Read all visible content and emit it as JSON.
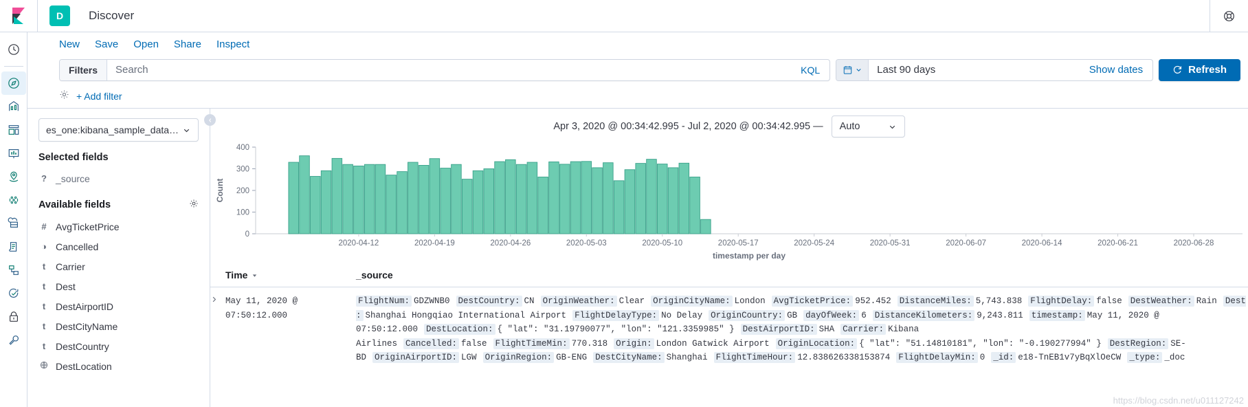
{
  "header": {
    "app_badge": "D",
    "title": "Discover",
    "logo_icon": "kibana-logo-icon",
    "help_icon": "help-circle-icon"
  },
  "rail": {
    "items": [
      {
        "name": "recently-viewed",
        "icon": "clock-icon",
        "active": false
      },
      {
        "name": "discover",
        "icon": "compass-icon",
        "active": true
      },
      {
        "name": "visualize",
        "icon": "bar-chart-icon",
        "active": false
      },
      {
        "name": "dashboard",
        "icon": "dashboard-icon",
        "active": false
      },
      {
        "name": "canvas",
        "icon": "presentation-icon",
        "active": false
      },
      {
        "name": "maps",
        "icon": "map-pin-icon",
        "active": false
      },
      {
        "name": "machine-learning",
        "icon": "ml-nodes-icon",
        "active": false
      },
      {
        "name": "infrastructure",
        "icon": "infra-icon",
        "active": false
      },
      {
        "name": "logs",
        "icon": "logs-document-icon",
        "active": false
      },
      {
        "name": "apm",
        "icon": "apm-trace-icon",
        "active": false
      },
      {
        "name": "uptime",
        "icon": "uptime-check-icon",
        "active": false
      },
      {
        "name": "security",
        "icon": "lock-icon",
        "active": false
      },
      {
        "name": "dev-tools",
        "icon": "wrench-icon",
        "active": false
      }
    ]
  },
  "nav": {
    "links": [
      "New",
      "Save",
      "Open",
      "Share",
      "Inspect"
    ]
  },
  "query_bar": {
    "filters_label": "Filters",
    "search_placeholder": "Search",
    "search_value": "",
    "language_label": "KQL",
    "calendar_icon": "calendar-icon",
    "chevron_icon": "chevron-down-icon",
    "date_range_label": "Last 90 days",
    "show_dates_label": "Show dates",
    "refresh_label": "Refresh",
    "refresh_icon": "refresh-icon",
    "accent_color": "#006BB4"
  },
  "filter_bar": {
    "settings_icon": "gear-icon",
    "add_filter_label": "+ Add filter"
  },
  "sidebar": {
    "index_pattern": "es_one:kibana_sample_data_flig...",
    "index_chevron_icon": "chevron-down-icon",
    "selected_fields_label": "Selected fields",
    "selected_fields": [
      {
        "type": "?",
        "name": "_source",
        "icon": "unknown-field-icon"
      }
    ],
    "available_fields_label": "Available fields",
    "available_fields_gear_icon": "gear-icon",
    "available_fields": [
      {
        "type": "#",
        "name": "AvgTicketPrice",
        "icon": "number-field-icon"
      },
      {
        "type": "◑",
        "name": "Cancelled",
        "icon": "boolean-field-icon"
      },
      {
        "type": "t",
        "name": "Carrier",
        "icon": "string-field-icon"
      },
      {
        "type": "t",
        "name": "Dest",
        "icon": "string-field-icon"
      },
      {
        "type": "t",
        "name": "DestAirportID",
        "icon": "string-field-icon"
      },
      {
        "type": "t",
        "name": "DestCityName",
        "icon": "string-field-icon"
      },
      {
        "type": "t",
        "name": "DestCountry",
        "icon": "string-field-icon"
      },
      {
        "type": "⊕",
        "name": "DestLocation",
        "icon": "geo-point-field-icon"
      }
    ]
  },
  "chart_header": {
    "range_text": "Apr 3, 2020 @ 00:34:42.995 - Jul 2, 2020 @ 00:34:42.995 —",
    "interval_value": "Auto",
    "interval_chevron_icon": "chevron-down-icon"
  },
  "chart_data": {
    "type": "bar",
    "title": "",
    "xlabel": "timestamp per day",
    "ylabel": "Count",
    "ylim": [
      0,
      400
    ],
    "yticks": [
      0,
      100,
      200,
      300,
      400
    ],
    "grid": false,
    "bar_color": "#6DCCB1",
    "bar_stroke": "#3aa18a",
    "x_axis_range": [
      "2020-04-03",
      "2020-07-02"
    ],
    "xticks": [
      "2020-04-12",
      "2020-04-19",
      "2020-04-26",
      "2020-05-03",
      "2020-05-10",
      "2020-05-17",
      "2020-05-24",
      "2020-05-31",
      "2020-06-07",
      "2020-06-14",
      "2020-06-21",
      "2020-06-28"
    ],
    "categories": [
      "2020-04-06",
      "2020-04-07",
      "2020-04-08",
      "2020-04-09",
      "2020-04-10",
      "2020-04-11",
      "2020-04-12",
      "2020-04-13",
      "2020-04-14",
      "2020-04-15",
      "2020-04-16",
      "2020-04-17",
      "2020-04-18",
      "2020-04-19",
      "2020-04-20",
      "2020-04-21",
      "2020-04-22",
      "2020-04-23",
      "2020-04-24",
      "2020-04-25",
      "2020-04-26",
      "2020-04-27",
      "2020-04-28",
      "2020-04-29",
      "2020-04-30",
      "2020-05-01",
      "2020-05-02",
      "2020-05-03",
      "2020-05-04",
      "2020-05-05",
      "2020-05-06",
      "2020-05-07",
      "2020-05-08",
      "2020-05-09",
      "2020-05-10",
      "2020-05-11"
    ],
    "values": [
      330,
      360,
      265,
      291,
      348,
      320,
      313,
      320,
      320,
      271,
      287,
      330,
      316,
      347,
      303,
      320,
      252,
      291,
      300,
      333,
      342,
      320,
      330,
      262,
      332,
      321,
      333,
      334,
      305,
      328,
      245,
      296,
      325,
      344,
      322,
      305
    ],
    "trailing_values": [
      326,
      262,
      66
    ]
  },
  "doc_table": {
    "columns": [
      "Time",
      "_source"
    ],
    "sort_icon": "sort-down-icon",
    "expand_icon": "chevron-right-icon",
    "rows": [
      {
        "time": "May 11, 2020 @ 07:50:12.000",
        "fields": [
          {
            "key": "FlightNum:",
            "value": "GDZWNB0"
          },
          {
            "key": "DestCountry:",
            "value": "CN"
          },
          {
            "key": "OriginWeather:",
            "value": "Clear"
          },
          {
            "key": "OriginCityName:",
            "value": "London"
          },
          {
            "key": "AvgTicketPrice:",
            "value": "952.452"
          },
          {
            "key": "DistanceMiles:",
            "value": "5,743.838"
          },
          {
            "key": "FlightDelay:",
            "value": "false"
          },
          {
            "key": "DestWeather:",
            "value": "Rain"
          },
          {
            "key": "Dest:",
            "value": "Shanghai Hongqiao International Airport"
          },
          {
            "key": "FlightDelayType:",
            "value": "No Delay"
          },
          {
            "key": "OriginCountry:",
            "value": "GB"
          },
          {
            "key": "dayOfWeek:",
            "value": "6"
          },
          {
            "key": "DistanceKilometers:",
            "value": "9,243.811"
          },
          {
            "key": "timestamp:",
            "value": "May 11, 2020 @ 07:50:12.000"
          },
          {
            "key": "DestLocation:",
            "value": "{ \"lat\": \"31.19790077\", \"lon\": \"121.3359985\" }"
          },
          {
            "key": "DestAirportID:",
            "value": "SHA"
          },
          {
            "key": "Carrier:",
            "value": "Kibana Airlines"
          },
          {
            "key": "Cancelled:",
            "value": "false"
          },
          {
            "key": "FlightTimeMin:",
            "value": "770.318"
          },
          {
            "key": "Origin:",
            "value": "London Gatwick Airport"
          },
          {
            "key": "OriginLocation:",
            "value": "{ \"lat\": \"51.14810181\", \"lon\": \"-0.190277994\" }"
          },
          {
            "key": "DestRegion:",
            "value": "SE-BD"
          },
          {
            "key": "OriginAirportID:",
            "value": "LGW"
          },
          {
            "key": "OriginRegion:",
            "value": "GB-ENG"
          },
          {
            "key": "DestCityName:",
            "value": "Shanghai"
          },
          {
            "key": "FlightTimeHour:",
            "value": "12.838626338153874"
          },
          {
            "key": "FlightDelayMin:",
            "value": "0"
          },
          {
            "key": "_id:",
            "value": "e18-TnEB1v7yBqXlOeCW"
          },
          {
            "key": "_type:",
            "value": "_doc"
          }
        ]
      }
    ]
  },
  "watermark": "https://blog.csdn.net/u011127242"
}
